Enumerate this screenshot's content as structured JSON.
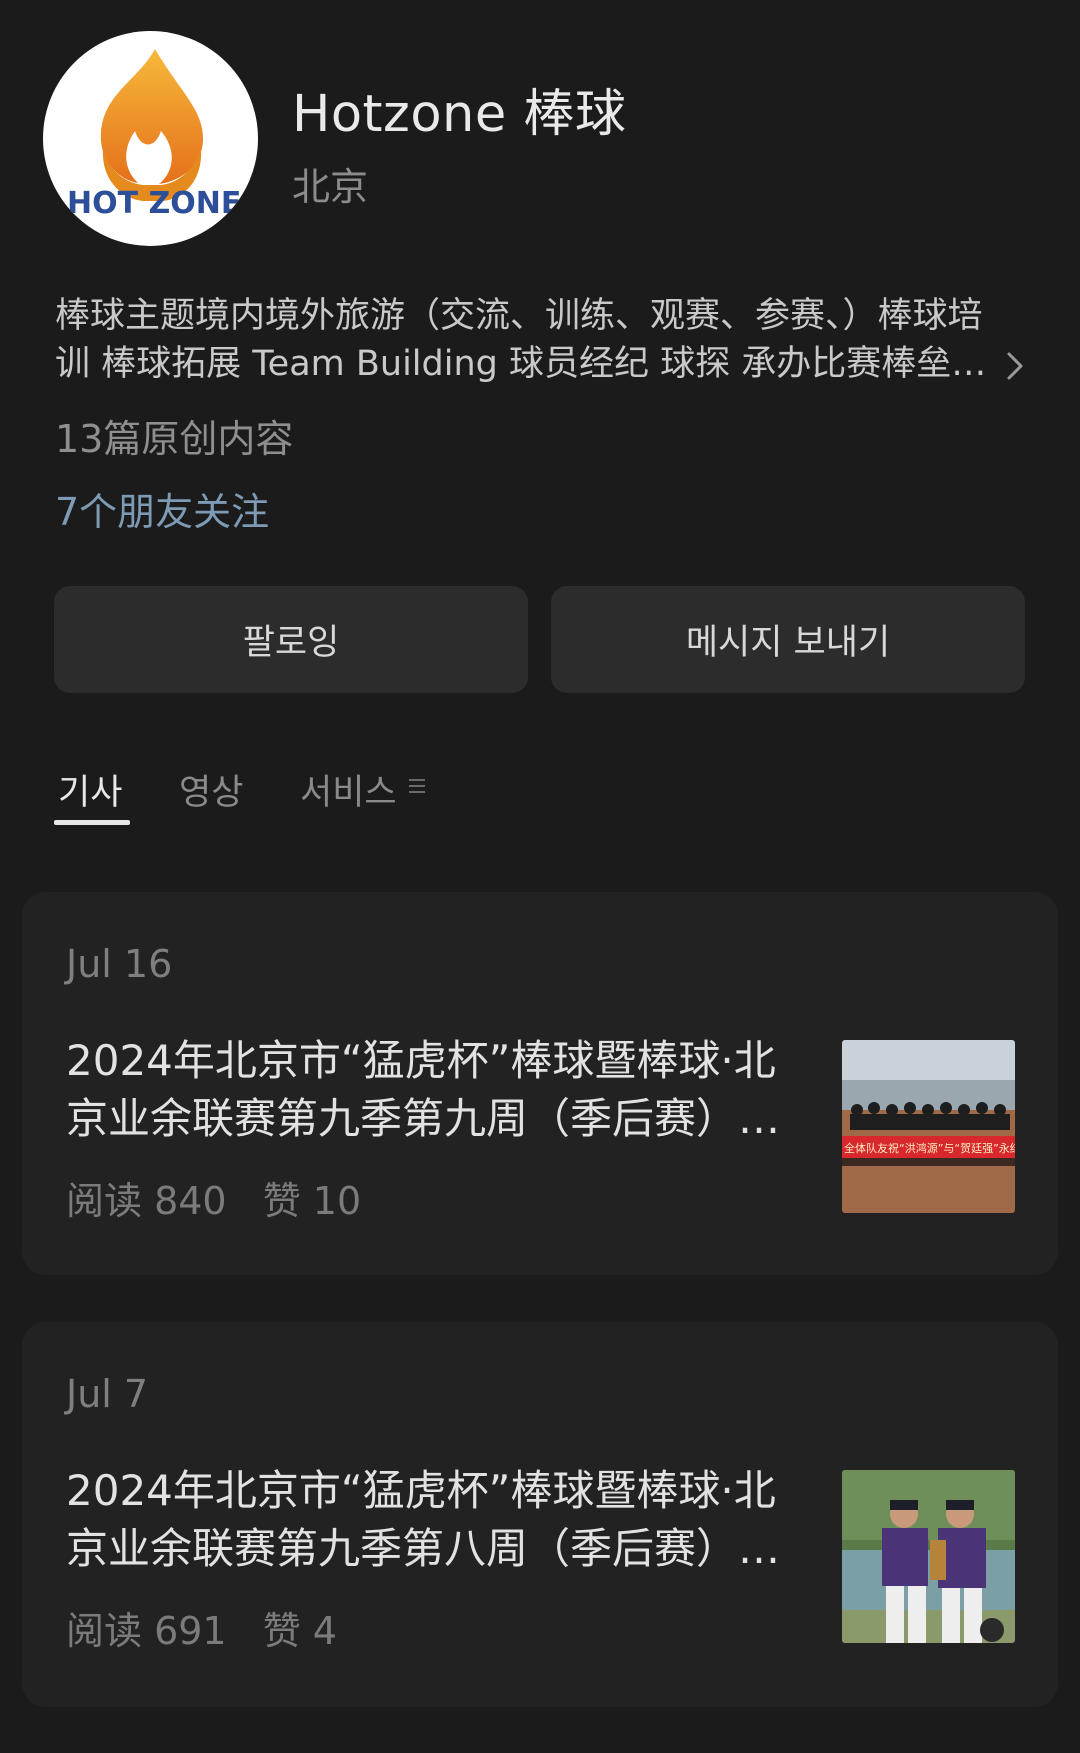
{
  "profile": {
    "name": "Hotzone 棒球",
    "location": "北京",
    "avatar_text": "HOT ZONE",
    "bio_line1": "棒球主题境内境外旅游（交流、训练、观赛、参赛、）棒球培",
    "bio_line2": "训  棒球拓展  Team Building 球员经纪 球探 承办比赛棒垒…",
    "original_count": "13篇原创内容",
    "friends_following": "7个朋友关注"
  },
  "buttons": {
    "follow": "팔로잉",
    "message": "메시지 보내기"
  },
  "tabs": [
    {
      "label": "기사",
      "active": true
    },
    {
      "label": "영상",
      "active": false
    },
    {
      "label": "서비스",
      "active": false
    }
  ],
  "articles": [
    {
      "date": "Jul 16",
      "title_line1": "2024年北京市“猛虎杯”棒球暨棒球·北",
      "title_line2": "京业余联赛第九季第九周（季后赛）…",
      "reads": "阅读 840",
      "likes": "赞 10",
      "thumb_banner_text": "全体队友祝“洪鸿源”与“贺廷强”永结同心"
    },
    {
      "date": "Jul 7",
      "title_line1": "2024年北京市“猛虎杯”棒球暨棒球·北",
      "title_line2": "京业余联赛第九季第八周（季后赛）…",
      "reads": "阅读 691",
      "likes": "赞 4"
    }
  ],
  "colors": {
    "background": "#1b1b1b",
    "card": "#222222",
    "button": "#2c2c2c",
    "link": "#7e9bb5",
    "logo_orange": "#f39a1f"
  }
}
